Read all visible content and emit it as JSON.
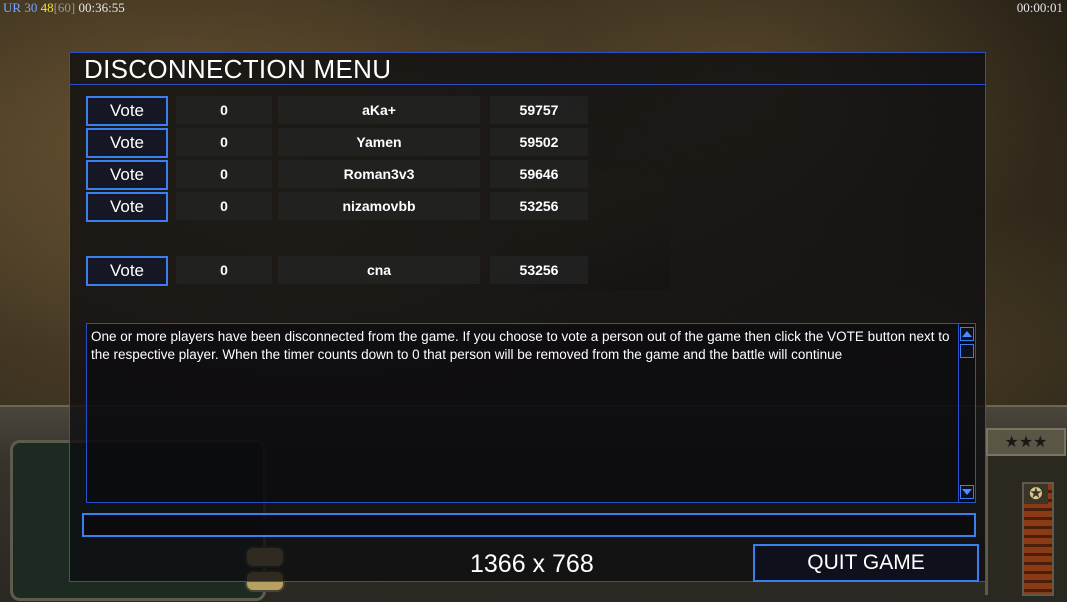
{
  "hud": {
    "fps_label": "UR",
    "fps_current": "30",
    "fps_avg": "48",
    "fps_max": "[60]",
    "elapsed_time": "00:36:55",
    "timer_right": "00:00:01"
  },
  "dialog": {
    "title": "DISCONNECTION MENU",
    "players": [
      {
        "vote_label": "Vote",
        "votes": "0",
        "name": "aKa+",
        "ping": "59757"
      },
      {
        "vote_label": "Vote",
        "votes": "0",
        "name": "Yamen",
        "ping": "59502"
      },
      {
        "vote_label": "Vote",
        "votes": "0",
        "name": "Roman3v3",
        "ping": "59646"
      },
      {
        "vote_label": "Vote",
        "votes": "0",
        "name": "nizamovbb",
        "ping": "53256"
      },
      {
        "vote_label": "Vote",
        "votes": "0",
        "name": "cna",
        "ping": "53256"
      }
    ],
    "message": "One or more players have been disconnected from the game. If you choose to vote a person out of the game then click the VOTE button next to the respective player. When the timer counts down to 0 that person will be removed from the game and the battle will continue",
    "resolution": "1366 x 768",
    "quit_label": "QUIT GAME"
  },
  "colors": {
    "accent_border": "#3a7ef0",
    "panel_bg": "#0e0e10"
  }
}
